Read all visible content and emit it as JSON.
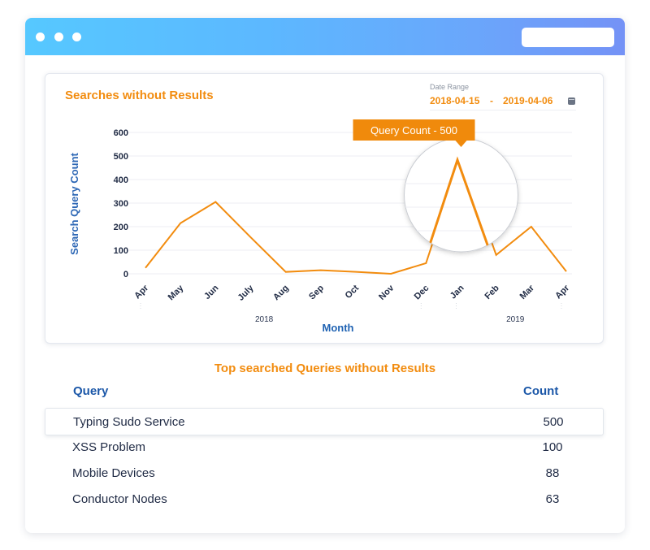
{
  "window": {
    "titlebar_dots": [
      "close",
      "minimize",
      "maximize"
    ],
    "colors": {
      "gradient_start": "#56c8ff",
      "gradient_end": "#7492f6",
      "accent": "#f28c0f",
      "heading_blue": "#1b57a8"
    }
  },
  "chart_card": {
    "title": "Searches without Results",
    "date_range": {
      "label": "Date Range",
      "from": "2018-04-15",
      "separator": "-",
      "to": "2019-04-06",
      "icon": "calendar-icon"
    },
    "tooltip": "Query Count - 500"
  },
  "chart_data": {
    "type": "line",
    "title": "Searches without Results",
    "xlabel": "Month",
    "ylabel": "Search Query Count",
    "categories": [
      "Apr",
      "May",
      "Jun",
      "July",
      "Aug",
      "Sep",
      "Oct",
      "Nov",
      "Dec",
      "Jan",
      "Feb",
      "Mar",
      "Apr"
    ],
    "year_labels": [
      "2018",
      "2019"
    ],
    "series": [
      {
        "name": "Query Count",
        "color": "#f28c0f",
        "values": [
          25,
          215,
          305,
          155,
          8,
          15,
          8,
          0,
          45,
          500,
          80,
          200,
          10
        ]
      }
    ],
    "yticks": [
      0,
      100,
      200,
      300,
      400,
      500,
      600
    ],
    "ylim": [
      0,
      600
    ],
    "grid": true,
    "highlight": {
      "category_index": 9,
      "label": "Query Count - 500",
      "magnifier": true
    }
  },
  "table": {
    "title": "Top searched Queries without Results",
    "columns": [
      "Query",
      "Count"
    ],
    "rows": [
      {
        "query": "Typing Sudo Service",
        "count": "500",
        "highlighted": true
      },
      {
        "query": "XSS Problem",
        "count": "100"
      },
      {
        "query": "Mobile Devices",
        "count": "88"
      },
      {
        "query": "Conductor Nodes",
        "count": "63"
      }
    ]
  }
}
